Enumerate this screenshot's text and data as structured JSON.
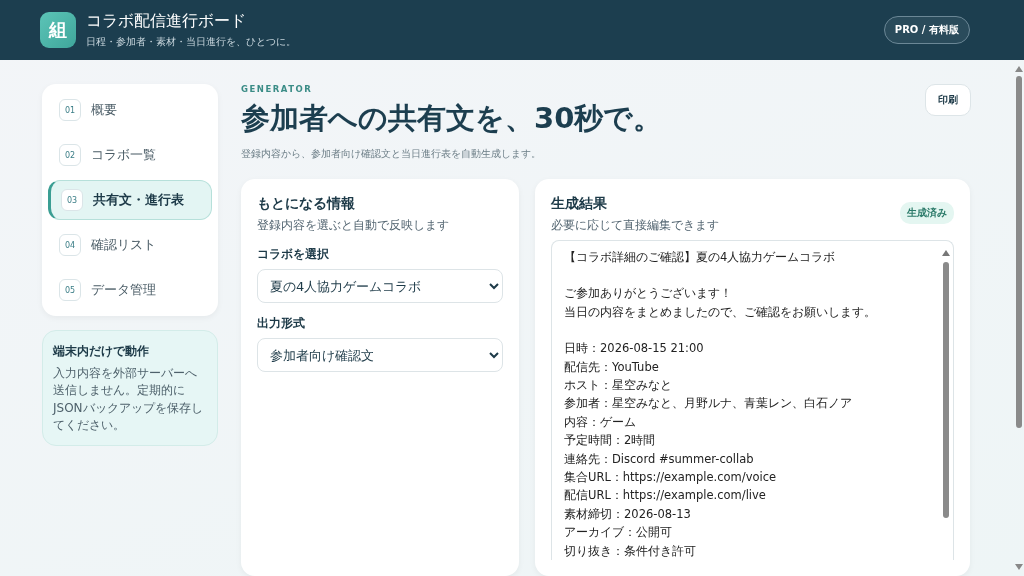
{
  "header": {
    "logo": "組",
    "title": "コラボ配信進行ボード",
    "subtitle": "日程・参加者・素材・当日進行を、ひとつに。",
    "plan_badge": "PRO / 有料版"
  },
  "sidebar": {
    "items": [
      {
        "number": "01",
        "label": "概要",
        "selected": false
      },
      {
        "number": "02",
        "label": "コラボ一覧",
        "selected": false
      },
      {
        "number": "03",
        "label": "共有文・進行表",
        "selected": true
      },
      {
        "number": "04",
        "label": "確認リスト",
        "selected": false
      },
      {
        "number": "05",
        "label": "データ管理",
        "selected": false
      }
    ],
    "notice": {
      "title": "端末内だけで動作",
      "text": "入力内容を外部サーバーへ送信しません。定期的にJSONバックアップを保存してください。"
    }
  },
  "main": {
    "eyebrow": "GENERATOR",
    "title": "参加者への共有文を、30秒で。",
    "description": "登録内容から、参加者向け確認文と当日進行表を自動生成します。",
    "print_button": "印刷",
    "source_card": {
      "title": "もとになる情報",
      "subtitle": "登録内容を選ぶと自動で反映します",
      "fields": [
        {
          "label": "コラボを選択",
          "value": "夏の4人協力ゲームコラボ"
        },
        {
          "label": "出力形式",
          "value": "参加者向け確認文"
        }
      ]
    },
    "result_card": {
      "title": "生成結果",
      "subtitle": "必要に応じて直接編集できます",
      "status_badge": "生成済み",
      "paragraphs": [
        [
          "【コラボ詳細のご確認】夏の4人協力ゲームコラボ"
        ],
        [
          "ご参加ありがとうございます！",
          "当日の内容をまとめましたので、ご確認をお願いします。"
        ],
        [
          "日時：2026-08-15 21:00",
          "配信先：YouTube",
          "ホスト：星空みなと",
          "参加者：星空みなと、月野ルナ、青葉レン、白石ノア",
          "内容：ゲーム",
          "予定時間：2時間",
          "連絡先：Discord #summer-collab",
          "集合URL：https://example.com/voice",
          "配信URL：https://example.com/live",
          "素材締切：2026-08-13",
          "アーカイブ：公開可",
          "切り抜き：条件付き許可"
        ]
      ]
    }
  }
}
